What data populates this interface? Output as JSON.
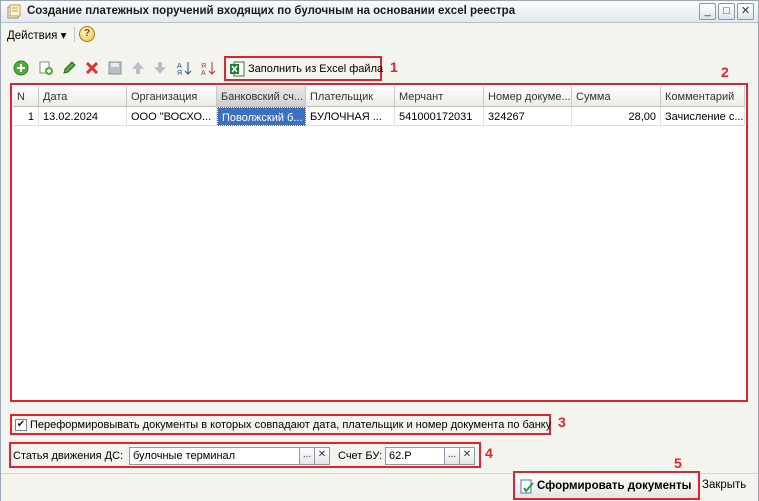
{
  "window": {
    "title": "Создание платежных поручений входящих по булочным на основании excel реестра",
    "minimize": "_",
    "maximize": "□",
    "close": "✕"
  },
  "menu": {
    "actions_label": "Действия ▾",
    "help_label": "?"
  },
  "toolbar": {
    "fill_from_excel_label": "Заполнить из Excel файла",
    "icons": [
      "add-icon",
      "copy-icon",
      "edit-icon",
      "delete-icon",
      "save-icon",
      "move-up-icon",
      "move-down-icon",
      "sort-asc-icon",
      "sort-desc-icon"
    ]
  },
  "table": {
    "columns": [
      "N",
      "Дата",
      "Организация",
      "Банковский сч...",
      "Плательщик",
      "Мерчант",
      "Номер докуме...",
      "Сумма",
      "Комментарий"
    ],
    "rows": [
      [
        "1",
        "13.02.2024",
        "ООО \"ВОСХО...",
        "Поволжский б...",
        "БУЛОЧНАЯ ...",
        "541000172031",
        "324267",
        "28,00",
        "Зачисление с..."
      ]
    ]
  },
  "options": {
    "reform_checkbox_label": "Переформировывать документы в которых совпадают дата, плательщик и номер документа по банку",
    "reform_checked": true,
    "check_mark": "✔"
  },
  "fields": {
    "cash_flow_label": "Статья движения ДС:",
    "cash_flow_value": "булочные терминал",
    "account_label": "Счет БУ:",
    "account_value": "62.Р",
    "select_btn": "...",
    "clear_btn": "✕"
  },
  "footer": {
    "generate_label": "Сформировать документы",
    "close_label": "Закрыть"
  },
  "annotations": [
    "1",
    "2",
    "3",
    "4",
    "5"
  ],
  "colors": {
    "highlight": "#e0242f",
    "selection": "#3f6fbd"
  }
}
